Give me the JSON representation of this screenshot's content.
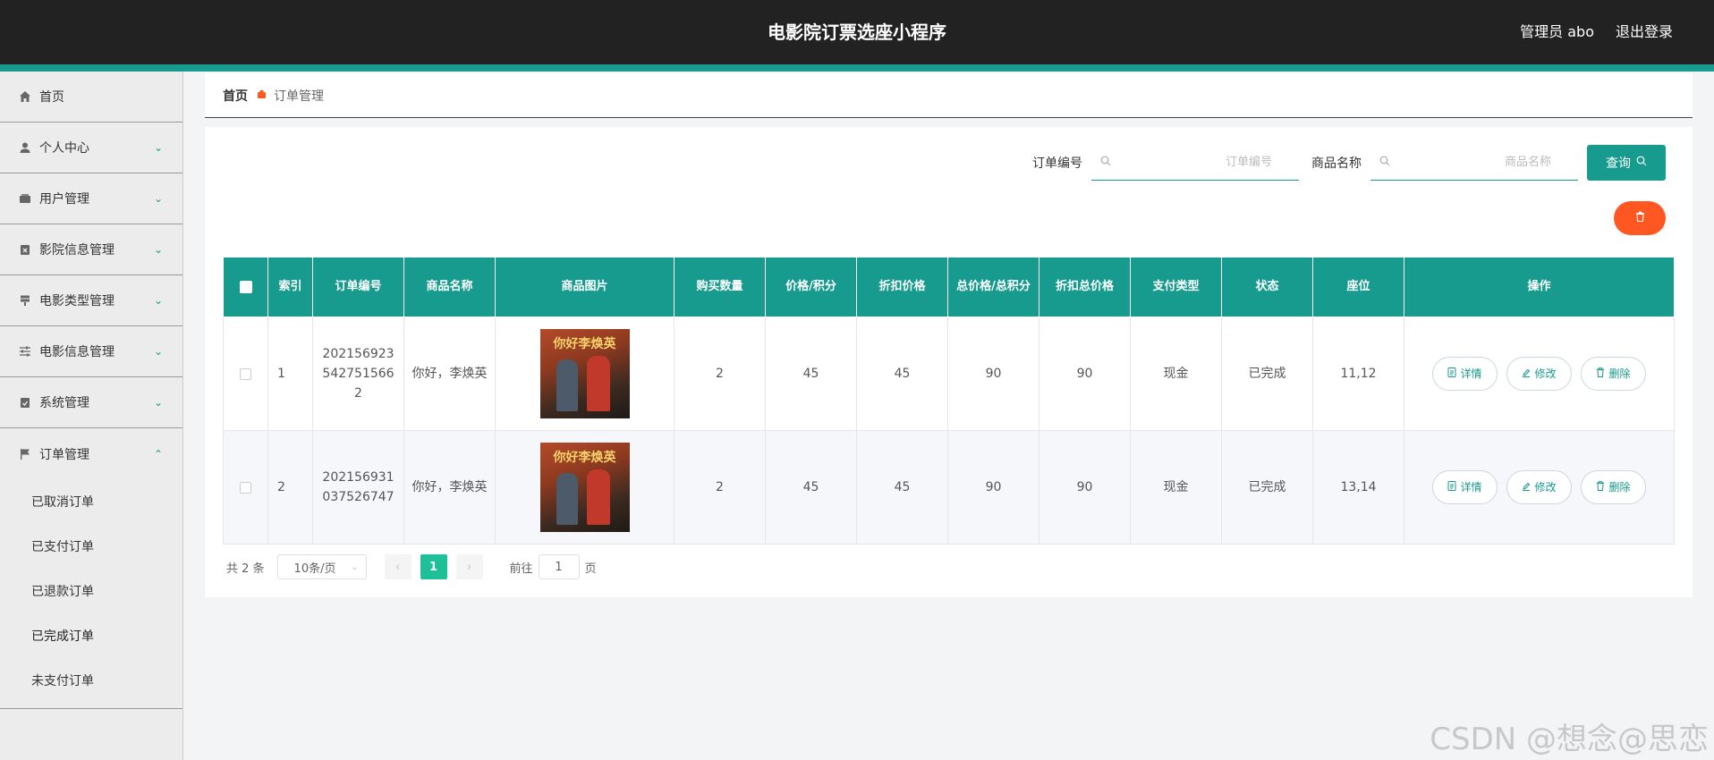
{
  "header": {
    "title": "电影院订票选座小程序",
    "user": "管理员 abo",
    "logout": "退出登录"
  },
  "sidebar": {
    "items": [
      {
        "label": "首页",
        "icon": "home-icon"
      },
      {
        "label": "个人中心",
        "icon": "user-icon"
      },
      {
        "label": "用户管理",
        "icon": "wallet-icon"
      },
      {
        "label": "影院信息管理",
        "icon": "clipboard-x-icon"
      },
      {
        "label": "电影类型管理",
        "icon": "stand-icon"
      },
      {
        "label": "电影信息管理",
        "icon": "sliders-icon"
      },
      {
        "label": "系统管理",
        "icon": "clipboard-check-icon"
      },
      {
        "label": "订单管理",
        "icon": "flag-icon"
      }
    ],
    "sub_items": [
      "已取消订单",
      "已支付订单",
      "已退款订单",
      "已完成订单",
      "未支付订单"
    ]
  },
  "breadcrumb": {
    "home": "首页",
    "current": "订单管理"
  },
  "search": {
    "order_label": "订单编号",
    "order_placeholder": "订单编号",
    "product_label": "商品名称",
    "product_placeholder": "商品名称",
    "query_label": "查询"
  },
  "table": {
    "columns": [
      "索引",
      "订单编号",
      "商品名称",
      "商品图片",
      "购买数量",
      "价格/积分",
      "折扣价格",
      "总价格/总积分",
      "折扣总价格",
      "支付类型",
      "状态",
      "座位",
      "操作"
    ],
    "rows": [
      {
        "index": "1",
        "order_no": "2021569235427515662",
        "product": "你好，李焕英",
        "poster_title": "你好李焕英",
        "qty": "2",
        "price": "45",
        "discount_price": "45",
        "total": "90",
        "discount_total": "90",
        "pay_type": "现金",
        "status": "已完成",
        "seat": "11,12"
      },
      {
        "index": "2",
        "order_no": "202156931037526747",
        "product": "你好，李焕英",
        "poster_title": "你好李焕英",
        "qty": "2",
        "price": "45",
        "discount_price": "45",
        "total": "90",
        "discount_total": "90",
        "pay_type": "现金",
        "status": "已完成",
        "seat": "13,14"
      }
    ],
    "actions": {
      "detail": "详情",
      "edit": "修改",
      "delete": "删除"
    }
  },
  "pager": {
    "total": "共 2 条",
    "page_size": "10条/页",
    "current_page": "1",
    "goto_prefix": "前往",
    "goto_value": "1",
    "goto_suffix": "页"
  },
  "watermark": "CSDN @想念@思恋",
  "colors": {
    "accent": "#179b8e",
    "danger": "#ff5722",
    "header": "#222222"
  }
}
